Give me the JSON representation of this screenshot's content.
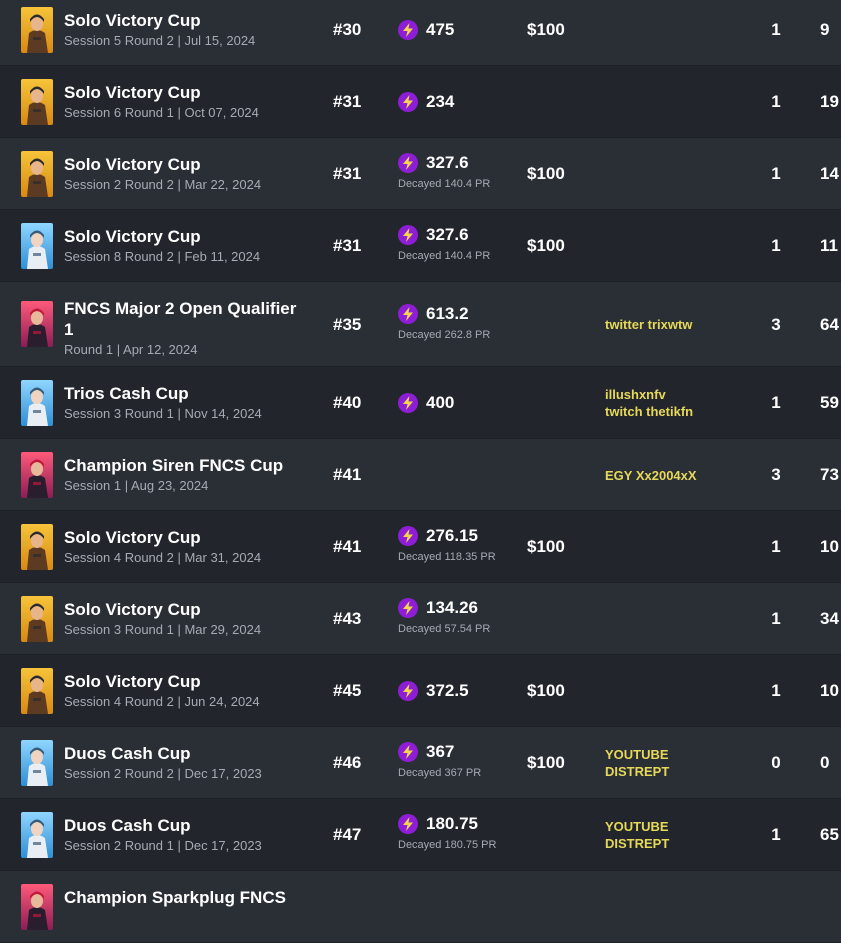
{
  "rows": [
    {
      "title": "Solo Victory Cup",
      "subtitle": "Session 5 Round 2 | Jul 15, 2024",
      "rank": "#30",
      "pr": "475",
      "decayed": "",
      "prize": "$100",
      "team": [],
      "elims": "1",
      "points": "9",
      "avatar": "gold"
    },
    {
      "title": "Solo Victory Cup",
      "subtitle": "Session 6 Round 1 | Oct 07, 2024",
      "rank": "#31",
      "pr": "234",
      "decayed": "",
      "prize": "",
      "team": [],
      "elims": "1",
      "points": "19",
      "avatar": "gold"
    },
    {
      "title": "Solo Victory Cup",
      "subtitle": "Session 2 Round 2 | Mar 22, 2024",
      "rank": "#31",
      "pr": "327.6",
      "decayed": "Decayed 140.4 PR",
      "prize": "$100",
      "team": [],
      "elims": "1",
      "points": "14",
      "avatar": "gold"
    },
    {
      "title": "Solo Victory Cup",
      "subtitle": "Session 8 Round 2 | Feb 11, 2024",
      "rank": "#31",
      "pr": "327.6",
      "decayed": "Decayed 140.4 PR",
      "prize": "$100",
      "team": [],
      "elims": "1",
      "points": "11",
      "avatar": "blue"
    },
    {
      "title": "FNCS Major 2 Open Qualifier 1",
      "subtitle": "Round 1 | Apr 12, 2024",
      "rank": "#35",
      "pr": "613.2",
      "decayed": "Decayed 262.8 PR",
      "prize": "",
      "team": [
        "twitter trixwtw"
      ],
      "elims": "3",
      "points": "64",
      "avatar": "red"
    },
    {
      "title": "Trios Cash Cup",
      "subtitle": "Session 3 Round 1 | Nov 14, 2024",
      "rank": "#40",
      "pr": "400",
      "decayed": "",
      "prize": "",
      "team": [
        "illushxnfv",
        "twitch thetikfn"
      ],
      "elims": "1",
      "points": "59",
      "avatar": "blue"
    },
    {
      "title": "Champion Siren FNCS Cup",
      "subtitle": "Session 1 | Aug 23, 2024",
      "rank": "#41",
      "pr": "",
      "decayed": "",
      "prize": "",
      "team": [
        "EGY Xx2004xX"
      ],
      "elims": "3",
      "points": "73",
      "avatar": "red"
    },
    {
      "title": "Solo Victory Cup",
      "subtitle": "Session 4 Round 2 | Mar 31, 2024",
      "rank": "#41",
      "pr": "276.15",
      "decayed": "Decayed 118.35 PR",
      "prize": "$100",
      "team": [],
      "elims": "1",
      "points": "10",
      "avatar": "gold"
    },
    {
      "title": "Solo Victory Cup",
      "subtitle": "Session 3 Round 1 | Mar 29, 2024",
      "rank": "#43",
      "pr": "134.26",
      "decayed": "Decayed 57.54 PR",
      "prize": "",
      "team": [],
      "elims": "1",
      "points": "34",
      "avatar": "gold"
    },
    {
      "title": "Solo Victory Cup",
      "subtitle": "Session 4 Round 2 | Jun 24, 2024",
      "rank": "#45",
      "pr": "372.5",
      "decayed": "",
      "prize": "$100",
      "team": [],
      "elims": "1",
      "points": "10",
      "avatar": "gold"
    },
    {
      "title": "Duos Cash Cup",
      "subtitle": "Session 2 Round 2 | Dec 17, 2023",
      "rank": "#46",
      "pr": "367",
      "decayed": "Decayed 367 PR",
      "prize": "$100",
      "team": [
        "YOUTUBE",
        "DISTREPT"
      ],
      "elims": "0",
      "points": "0",
      "avatar": "blue"
    },
    {
      "title": "Duos Cash Cup",
      "subtitle": "Session 2 Round 1 | Dec 17, 2023",
      "rank": "#47",
      "pr": "180.75",
      "decayed": "Decayed 180.75 PR",
      "prize": "",
      "team": [
        "YOUTUBE",
        "DISTREPT"
      ],
      "elims": "1",
      "points": "65",
      "avatar": "blue"
    },
    {
      "title": "Champion Sparkplug FNCS",
      "subtitle": "",
      "rank": "",
      "pr": "",
      "decayed": "",
      "prize": "",
      "team": [],
      "elims": "",
      "points": "",
      "avatar": "red"
    }
  ],
  "colors": {
    "row_dark": "#22252b",
    "row_light": "#2a2e35",
    "team_text": "#e6d95a",
    "pr_icon": "#8e1ed6",
    "subtitle": "#a6abb3"
  },
  "icons": {
    "pr": "lightning-bolt-icon",
    "avatar": "skin-avatar-icon"
  }
}
